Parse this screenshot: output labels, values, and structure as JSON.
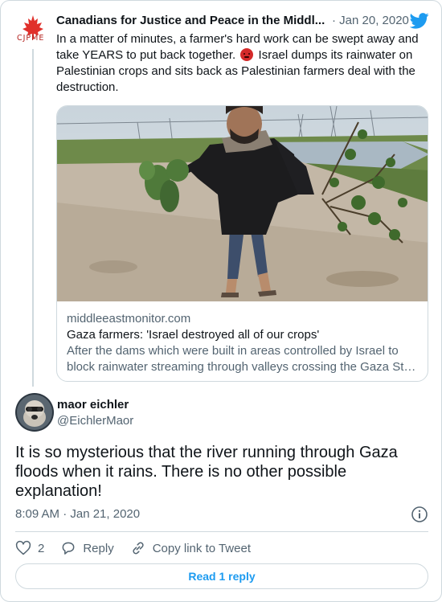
{
  "parent_tweet": {
    "author": "Canadians for Justice and Peace in the Middl...",
    "date": "· Jan 20, 2020",
    "avatar_label": "CJPME",
    "text_before_emoji": "In a matter of minutes, a farmer's hard work can be swept away and take YEARS to put back together. ",
    "text_after_emoji": " Israel dumps its rainwater on Palestinian crops and sits back as Palestinian farmers deal with the destruction.",
    "link_card": {
      "domain": "middleeastmonitor.com",
      "title": "Gaza farmers: 'Israel destroyed all of our crops'",
      "description": "After the dams which were built in areas controlled by Israel to block rainwater streaming through valleys crossing the Gaza St…"
    }
  },
  "reply_tweet": {
    "name": "maor eichler",
    "handle": "@EichlerMaor",
    "text": "It is so mysterious that the river running through Gaza floods when it rains. There is no other possible explanation!",
    "timestamp": "8:09 AM · Jan 21, 2020"
  },
  "actions": {
    "like_count": "2",
    "reply_label": "Reply",
    "copy_link_label": "Copy link to Tweet"
  },
  "read_replies_label": "Read 1 reply",
  "colors": {
    "accent": "#1d9bf0",
    "text_primary": "#0f1419",
    "text_secondary": "#536471",
    "border": "#cfd9de",
    "cjpme_red": "#b3211d"
  },
  "icons": [
    "maple-leaf-icon",
    "twitter-bird-icon",
    "info-icon",
    "heart-icon",
    "reply-icon",
    "link-icon"
  ]
}
